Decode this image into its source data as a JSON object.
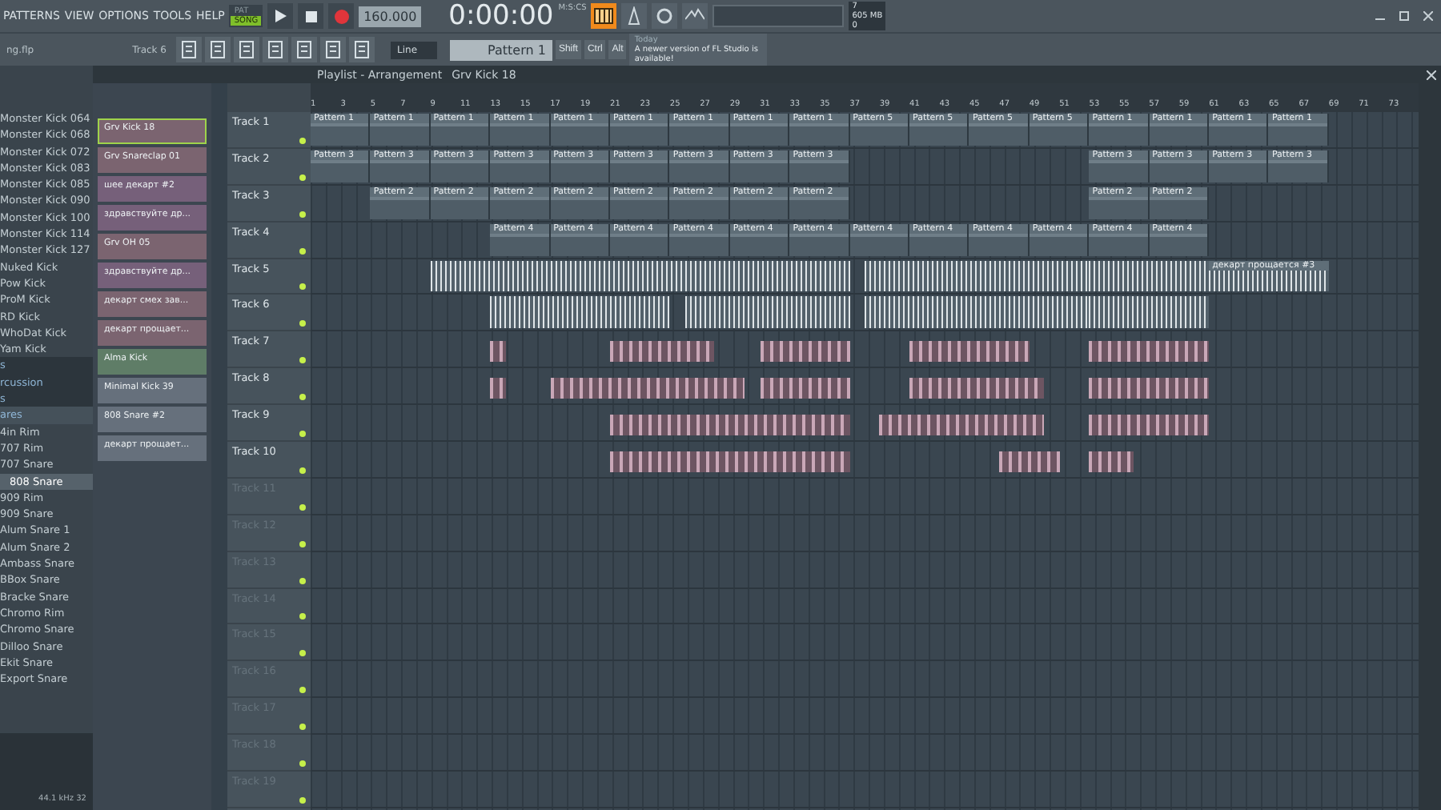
{
  "menu": [
    "PATTERNS",
    "VIEW",
    "OPTIONS",
    "TOOLS",
    "HELP"
  ],
  "mode": [
    {
      "label": "PAT",
      "selected": false
    },
    {
      "label": "SONG",
      "selected": true
    }
  ],
  "tempo": "160.000",
  "time": "0:00:00",
  "time_unit": "M:S:CS",
  "cpu": "7",
  "memory": "605 MB",
  "polyphony": "0",
  "project_file": "ng.flp",
  "focus_hint": "Track 6",
  "snap": "Line",
  "pattern": "Pattern 1",
  "modifiers": [
    "Shift",
    "Ctrl",
    "Alt"
  ],
  "news": {
    "label": "Today",
    "text": "A newer version of FL Studio is available!"
  },
  "browser": {
    "items": [
      {
        "label": "Monster Kick 064",
        "kind": "item",
        "selected": false
      },
      {
        "label": "Monster Kick 068",
        "kind": "item",
        "selected": false
      },
      {
        "label": "Monster Kick 072",
        "kind": "item",
        "selected": false
      },
      {
        "label": "Monster Kick 083",
        "kind": "item",
        "selected": false
      },
      {
        "label": "Monster Kick 085",
        "kind": "item",
        "selected": false
      },
      {
        "label": "Monster Kick 090",
        "kind": "item",
        "selected": false
      },
      {
        "label": "Monster Kick 100",
        "kind": "item",
        "selected": false
      },
      {
        "label": "Monster Kick 114",
        "kind": "item",
        "selected": false
      },
      {
        "label": "Monster Kick 127",
        "kind": "item",
        "selected": false
      },
      {
        "label": "Nuked Kick",
        "kind": "item",
        "selected": false
      },
      {
        "label": "Pow Kick",
        "kind": "item",
        "selected": false
      },
      {
        "label": "ProM Kick",
        "kind": "item",
        "selected": false
      },
      {
        "label": "RD Kick",
        "kind": "item",
        "selected": false
      },
      {
        "label": "WhoDat Kick",
        "kind": "item",
        "selected": false
      },
      {
        "label": "Yam Kick",
        "kind": "item",
        "selected": false
      },
      {
        "label": "s",
        "kind": "folder",
        "selected": false
      },
      {
        "label": "rcussion",
        "kind": "folder",
        "selected": false
      },
      {
        "label": "s",
        "kind": "folder",
        "selected": false
      },
      {
        "label": "ares",
        "kind": "header",
        "selected": false
      },
      {
        "label": "4in Rim",
        "kind": "item",
        "selected": false
      },
      {
        "label": "707 Rim",
        "kind": "item",
        "selected": false
      },
      {
        "label": "707 Snare",
        "kind": "item",
        "selected": false
      },
      {
        "label": "808 Snare",
        "kind": "item",
        "selected": true
      },
      {
        "label": "909 Rim",
        "kind": "item",
        "selected": false
      },
      {
        "label": "909 Snare",
        "kind": "item",
        "selected": false
      },
      {
        "label": "Alum Snare 1",
        "kind": "item",
        "selected": false
      },
      {
        "label": "Alum Snare 2",
        "kind": "item",
        "selected": false
      },
      {
        "label": "Ambass Snare",
        "kind": "item",
        "selected": false
      },
      {
        "label": "BBox Snare",
        "kind": "item",
        "selected": false
      },
      {
        "label": "Bracke Snare",
        "kind": "item",
        "selected": false
      },
      {
        "label": "Chromo Rim",
        "kind": "item",
        "selected": false
      },
      {
        "label": "Chromo Snare",
        "kind": "item",
        "selected": false
      },
      {
        "label": "Dilloo Snare",
        "kind": "item",
        "selected": false
      },
      {
        "label": "Ekit Snare",
        "kind": "item",
        "selected": false
      },
      {
        "label": "Export Snare",
        "kind": "item",
        "selected": false
      }
    ],
    "sample_info": "44.1 kHz 32"
  },
  "playlist": {
    "title": "Playlist - Arrangement",
    "channel": "Grv Kick 18"
  },
  "channels": [
    {
      "label": "Grv Kick 18",
      "color": "#7b6470",
      "selected": true
    },
    {
      "label": "Grv Snareclap 01",
      "color": "#7b6470",
      "selected": false
    },
    {
      "label": "шее декарт #2",
      "color": "#76607a",
      "selected": false
    },
    {
      "label": "здравствуйте др...",
      "color": "#76607a",
      "selected": false
    },
    {
      "label": "Grv OH 05",
      "color": "#7b6470",
      "selected": false
    },
    {
      "label": "здравствуйте др...",
      "color": "#76607a",
      "selected": false
    },
    {
      "label": "декарт смех зав...",
      "color": "#7b6470",
      "selected": false
    },
    {
      "label": "декарт прощает...",
      "color": "#7b6470",
      "selected": false
    },
    {
      "label": "Alma Kick",
      "color": "#5f7d67",
      "selected": false
    },
    {
      "label": "Minimal Kick 39",
      "color": "#66707c",
      "selected": false
    },
    {
      "label": "808 Snare #2",
      "color": "#66707c",
      "selected": false
    },
    {
      "label": "декарт прощает...",
      "color": "#66707c",
      "selected": false
    }
  ],
  "ruler": [
    "1",
    "3",
    "5",
    "7",
    "9",
    "11",
    "13",
    "15",
    "17",
    "19",
    "21",
    "23",
    "25",
    "27",
    "29",
    "31",
    "33",
    "35",
    "37",
    "39",
    "41",
    "43",
    "45",
    "47",
    "49",
    "51",
    "53",
    "55",
    "57",
    "59",
    "61",
    "63",
    "65",
    "67",
    "69",
    "71",
    "73"
  ],
  "tracks": [
    {
      "name": "Track 1",
      "used": true,
      "clips": [
        {
          "kind": "pattern",
          "label": "Pattern 1"
        },
        {
          "kind": "pattern",
          "label": "Pattern 1"
        },
        {
          "kind": "pattern",
          "label": "Pattern 1"
        },
        {
          "kind": "pattern",
          "label": "Pattern 1"
        },
        {
          "kind": "pattern",
          "label": "Pattern 1"
        },
        {
          "kind": "pattern",
          "label": "Pattern 1"
        },
        {
          "kind": "pattern",
          "label": "Pattern 1"
        },
        {
          "kind": "pattern",
          "label": "Pattern 1"
        },
        {
          "kind": "pattern",
          "label": "Pattern 1"
        },
        {
          "kind": "pattern",
          "label": "Pattern 5"
        },
        {
          "kind": "pattern",
          "label": "Pattern 5"
        },
        {
          "kind": "pattern",
          "label": "Pattern 5"
        },
        {
          "kind": "pattern",
          "label": "Pattern 5"
        },
        {
          "kind": "pattern",
          "label": "Pattern 1"
        },
        {
          "kind": "pattern",
          "label": "Pattern 1"
        },
        {
          "kind": "pattern",
          "label": "Pattern 1"
        },
        {
          "kind": "pattern",
          "label": "Pattern 1"
        }
      ]
    },
    {
      "name": "Track 2",
      "used": true,
      "clips": [
        {
          "kind": "pattern",
          "label": "Pattern 3"
        },
        {
          "kind": "pattern",
          "label": "Pattern 3"
        },
        {
          "kind": "pattern",
          "label": "Pattern 3"
        },
        {
          "kind": "pattern",
          "label": "Pattern 3"
        },
        {
          "kind": "pattern",
          "label": "Pattern 3"
        },
        {
          "kind": "pattern",
          "label": "Pattern 3"
        },
        {
          "kind": "pattern",
          "label": "Pattern 3"
        },
        {
          "kind": "pattern",
          "label": "Pattern 3"
        },
        {
          "kind": "pattern",
          "label": "Pattern 3"
        },
        {
          "kind": "pattern",
          "label": "Pattern 3"
        },
        {
          "kind": "pattern",
          "label": "Pattern 3"
        },
        {
          "kind": "pattern",
          "label": "Pattern 3"
        },
        {
          "kind": "pattern",
          "label": "Pattern 3"
        }
      ]
    },
    {
      "name": "Track 3",
      "used": true,
      "clips": [
        {
          "kind": "pattern",
          "label": "Pattern 2"
        },
        {
          "kind": "pattern",
          "label": "Pattern 2"
        },
        {
          "kind": "pattern",
          "label": "Pattern 2"
        },
        {
          "kind": "pattern",
          "label": "Pattern 2"
        },
        {
          "kind": "pattern",
          "label": "Pattern 2"
        },
        {
          "kind": "pattern",
          "label": "Pattern 2"
        },
        {
          "kind": "pattern",
          "label": "Pattern 2"
        },
        {
          "kind": "pattern",
          "label": "Pattern 2"
        },
        {
          "kind": "pattern",
          "label": "Pattern 2"
        },
        {
          "kind": "pattern",
          "label": "Pattern 2"
        }
      ]
    },
    {
      "name": "Track 4",
      "used": true,
      "clips": [
        {
          "kind": "pattern",
          "label": "Pattern 4"
        },
        {
          "kind": "pattern",
          "label": "Pattern 4"
        },
        {
          "kind": "pattern",
          "label": "Pattern 4"
        },
        {
          "kind": "pattern",
          "label": "Pattern 4"
        },
        {
          "kind": "pattern",
          "label": "Pattern 4"
        },
        {
          "kind": "pattern",
          "label": "Pattern 4"
        },
        {
          "kind": "pattern",
          "label": "Pattern 4"
        },
        {
          "kind": "pattern",
          "label": "Pattern 4"
        },
        {
          "kind": "pattern",
          "label": "Pattern 4"
        },
        {
          "kind": "pattern",
          "label": "Pattern 4"
        },
        {
          "kind": "pattern",
          "label": "Pattern 4"
        },
        {
          "kind": "pattern",
          "label": "Pattern 4"
        }
      ]
    },
    {
      "name": "Track 5",
      "used": true,
      "clips": [
        {
          "kind": "audio"
        },
        {
          "kind": "audio"
        },
        {
          "kind": "audio"
        },
        {
          "kind": "audio",
          "label": "декарт прощается #3"
        }
      ]
    },
    {
      "name": "Track 6",
      "used": true,
      "clips": [
        {
          "kind": "audio"
        },
        {
          "kind": "audio"
        },
        {
          "kind": "audio"
        },
        {
          "kind": "audio"
        }
      ]
    },
    {
      "name": "Track 7",
      "used": true,
      "clips": [
        {
          "kind": "hit"
        },
        {
          "kind": "hit"
        },
        {
          "kind": "hit"
        },
        {
          "kind": "hit"
        },
        {
          "kind": "hit"
        }
      ]
    },
    {
      "name": "Track 8",
      "used": true,
      "clips": [
        {
          "kind": "hit"
        },
        {
          "kind": "hit"
        },
        {
          "kind": "hit"
        },
        {
          "kind": "hit"
        },
        {
          "kind": "hit"
        }
      ]
    },
    {
      "name": "Track 9",
      "used": true,
      "clips": [
        {
          "kind": "hit"
        },
        {
          "kind": "hit"
        },
        {
          "kind": "hit"
        }
      ]
    },
    {
      "name": "Track 10",
      "used": true,
      "clips": [
        {
          "kind": "hit"
        },
        {
          "kind": "hit"
        },
        {
          "kind": "hit"
        }
      ]
    },
    {
      "name": "Track 11",
      "used": false
    },
    {
      "name": "Track 12",
      "used": false
    },
    {
      "name": "Track 13",
      "used": false
    },
    {
      "name": "Track 14",
      "used": false
    },
    {
      "name": "Track 15",
      "used": false
    },
    {
      "name": "Track 16",
      "used": false
    },
    {
      "name": "Track 17",
      "used": false
    },
    {
      "name": "Track 18",
      "used": false
    },
    {
      "name": "Track 19",
      "used": false
    }
  ]
}
